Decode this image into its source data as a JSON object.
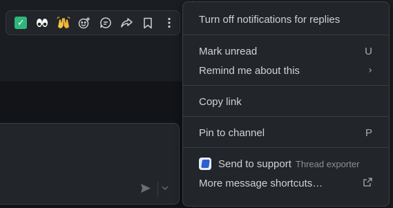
{
  "toolbar": {
    "actions": [
      {
        "name": "reaction-check-mark",
        "glyph": "✓"
      },
      {
        "name": "reaction-eyes",
        "glyph": "👀"
      },
      {
        "name": "reaction-raised-hands",
        "glyph": "🙌"
      },
      {
        "name": "add-reaction",
        "glyph": "☺+"
      },
      {
        "name": "reply-in-thread",
        "glyph": "💬"
      },
      {
        "name": "forward-message",
        "glyph": "↪"
      },
      {
        "name": "save-for-later",
        "glyph": "🔖"
      },
      {
        "name": "more-actions",
        "glyph": "⋮"
      }
    ]
  },
  "menu": {
    "turn_off_notifications": "Turn off notifications for replies",
    "mark_unread": "Mark unread",
    "mark_unread_shortcut": "U",
    "remind_me": "Remind me about this",
    "remind_me_arrow": "›",
    "copy_link": "Copy link",
    "pin_to_channel": "Pin to channel",
    "pin_shortcut": "P",
    "send_to_support": "Send to support",
    "send_to_support_app": "Thread exporter",
    "more_shortcuts": "More message shortcuts…",
    "more_shortcuts_icon": "↗"
  },
  "colors": {
    "background": "#1a1d21",
    "menu_bg": "#222529",
    "text": "#d1d2d3",
    "check_green": "#2eb67d"
  }
}
